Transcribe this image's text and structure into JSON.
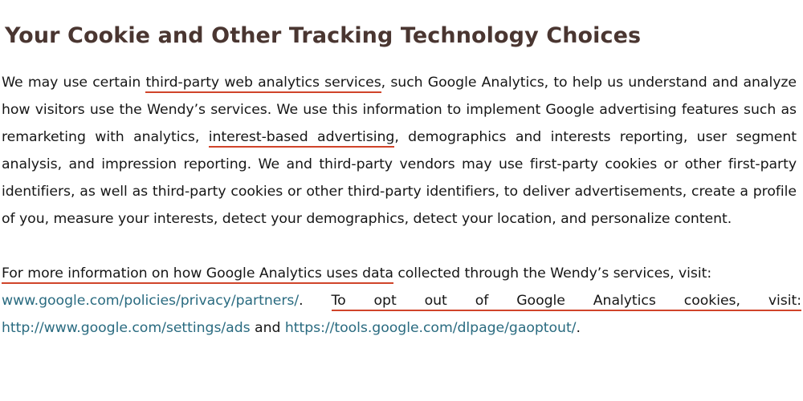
{
  "document": {
    "heading": "Your Cookie and Other Tracking Technology Choices",
    "heading_color": "#4a3631",
    "body_color": "#161616",
    "underline_color": "#d0442a",
    "link_color": "#2a6b80",
    "background_color": "#ffffff"
  },
  "paragraph1": {
    "segment_1": "We may use certain ",
    "highlight_1": "third-party web analytics services",
    "segment_2": ", such Google Analytics, to help us understand and analyze how visitors use the Wendy’s services. We use this information to implement Google advertising features such as remarketing with analytics, ",
    "highlight_2": "interest-based advertising",
    "segment_3": ", demographics and interests reporting, user segment analysis, and impression reporting. We and third-party vendors may use first-party cookies or other first-party identifiers, as well as third-party cookies or other third-party identifiers, to deliver advertisements, create a profile of you, measure your interests, detect your demographics, detect your location, and personalize content."
  },
  "paragraph2": {
    "highlight_1": "For more information on how Google Analytics uses data",
    "segment_1": " collected through the Wendy’s services, visit:"
  },
  "paragraph3": {
    "link_1": "www.google.com/policies/privacy/partners/",
    "segment_1": ".  ",
    "highlight_1": "To opt out of Google Analytics cookies, visit:",
    "segment_2": " ",
    "link_2": "http://www.google.com/settings/ads",
    "segment_3": " and ",
    "link_3": "https://tools.google.com/dlpage/gaoptout/",
    "segment_4": "."
  }
}
